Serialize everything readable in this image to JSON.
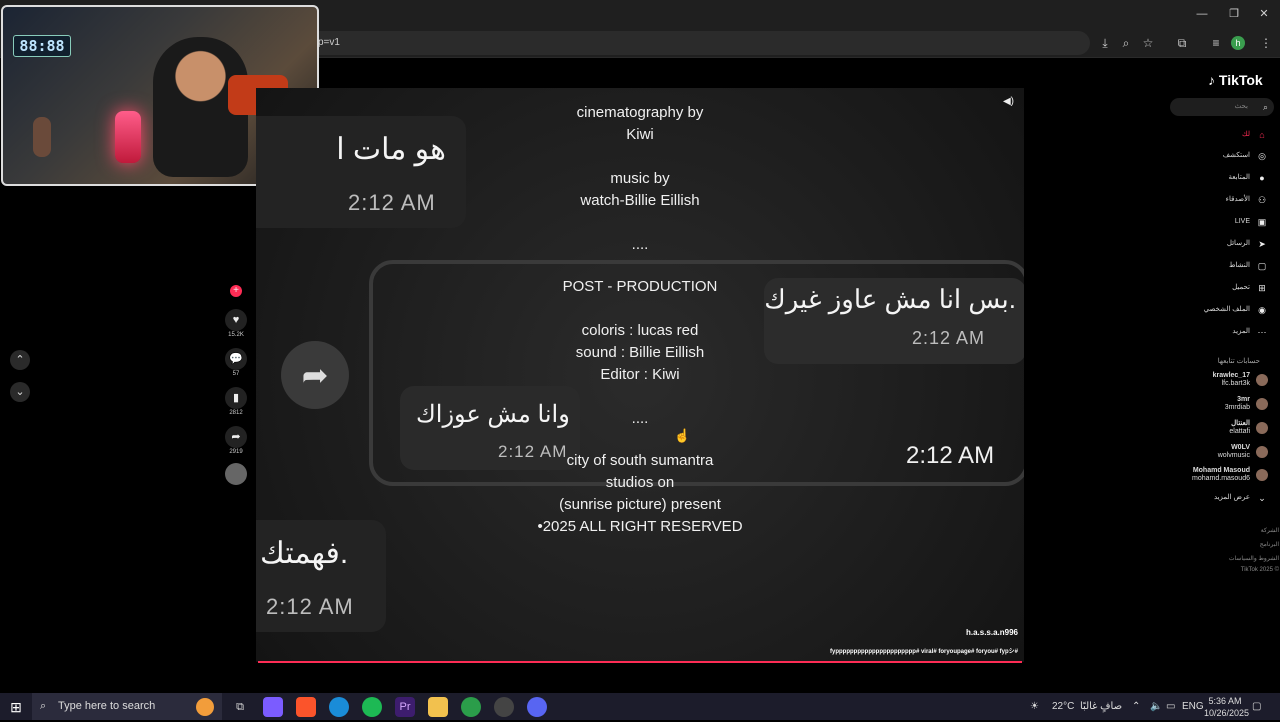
{
  "browser": {
    "url_fragment": "p=v1",
    "icons": [
      "install-icon",
      "zoom-icon",
      "star-icon",
      "extensions-icon",
      "media-icon",
      "profile-icon",
      "more-icon"
    ],
    "profile_initial": "h",
    "window_controls": {
      "minimize": "—",
      "restore": "❐",
      "close": "✕"
    }
  },
  "webcam": {
    "clock": "88:88"
  },
  "video": {
    "bubbles": {
      "top_left": {
        "msg": "هو مات ا",
        "time": "2:12 AM"
      },
      "right": {
        "msg": "بس انا مش عاوز غيرك.",
        "time": "2:12 AM"
      },
      "middle": {
        "msg": "وانا مش عوزاك",
        "time": "2:12 AM"
      },
      "bottom_left": {
        "msg": "فهمتك.",
        "time": "2:12 AM"
      },
      "right_time_big": "2:12 AM"
    },
    "credits": {
      "block1": [
        "cinematography by",
        "Kiwi"
      ],
      "block2": [
        "music by",
        "watch-Billie Eillish"
      ],
      "dots1": "....",
      "block3": [
        "POST - PRODUCTION"
      ],
      "block4": [
        "coloris : lucas red",
        "sound : Billie Eillish",
        "Editor : Kiwi"
      ],
      "dots2": "....",
      "block5": [
        "city of south sumantra",
        "studios on",
        "(sunrise picture) present",
        "•2025 ALL RIGHT RESERVED"
      ]
    },
    "author_handle": "h.a.s.s.a.n996",
    "hashtags": "fypppppppppppppppppppppp# viral# foryoupage# foryou# fypシ#"
  },
  "actions": {
    "likes": "15.2K",
    "comments": "57",
    "bookmarks": "2812",
    "shares": "2919"
  },
  "tiktok": {
    "logo": "TikTok",
    "search_placeholder": "بحث",
    "nav": [
      {
        "label": "لك",
        "icon": "home-icon",
        "glyph": "⌂"
      },
      {
        "label": "استكشف",
        "icon": "compass-icon",
        "glyph": "◎"
      },
      {
        "label": "المتابعة",
        "icon": "following-icon",
        "glyph": "●"
      },
      {
        "label": "الأصدقاء",
        "icon": "friends-icon",
        "glyph": "⚇"
      },
      {
        "label": "LIVE",
        "icon": "live-icon",
        "glyph": "▣"
      },
      {
        "label": "الرسائل",
        "icon": "messages-icon",
        "glyph": "➤"
      },
      {
        "label": "النشاط",
        "icon": "activity-icon",
        "glyph": "▢"
      },
      {
        "label": "تحميل",
        "icon": "upload-icon",
        "glyph": "⊞"
      },
      {
        "label": "الملف الشخصي",
        "icon": "profile-icon",
        "glyph": "◉"
      },
      {
        "label": "المزيد",
        "icon": "more-icon",
        "glyph": "⋯"
      }
    ],
    "following_title": "حسابات تتابعها",
    "following": [
      {
        "name": "krawlec_17",
        "sub": "lfc.bart3k"
      },
      {
        "name": "3mr",
        "sub": "3mrdiab"
      },
      {
        "name": "العنتال",
        "sub": "elattafi"
      },
      {
        "name": "W0LV",
        "sub": "wolvmusic"
      },
      {
        "name": "Mohamd Masoud",
        "sub": "mohamd.masoud6"
      }
    ],
    "show_more": "عرض المزيد",
    "footer": [
      "الشركة",
      "البرنامج",
      "الشروط والسياسات",
      "TikTok 2025 ©"
    ]
  },
  "taskbar": {
    "search_placeholder": "Type here to search",
    "weather": "22°C",
    "weather_text": "صافٍ غالبًا",
    "lang": "ENG",
    "time": "5:36 AM",
    "date": "10/26/2025"
  }
}
